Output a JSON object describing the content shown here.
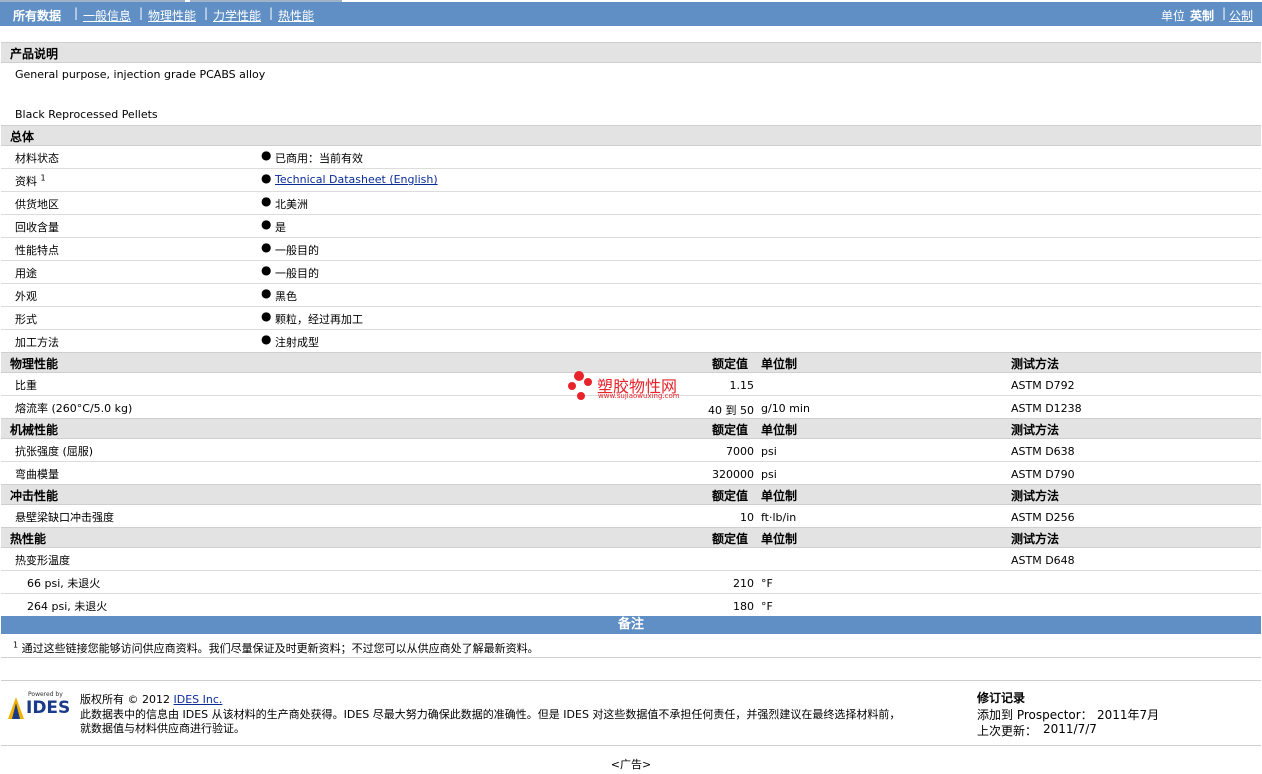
{
  "nav": {
    "items": [
      "所有数据",
      "一般信息",
      "物理性能",
      "力学性能",
      "热性能"
    ],
    "unit_label": "单位",
    "unit_english": "英制",
    "unit_metric": "公制"
  },
  "product": {
    "header": "产品说明",
    "line1": "General purpose, injection grade PCABS alloy",
    "line2": "Black Reprocessed Pellets"
  },
  "general": {
    "header": "总体",
    "rows": [
      {
        "label": "材料状态",
        "value": "已商用：当前有效"
      },
      {
        "label": "资料",
        "sup": "1",
        "value": "Technical Datasheet (English)"
      },
      {
        "label": "供货地区",
        "value": "北美洲"
      },
      {
        "label": "回收含量",
        "value": "是"
      },
      {
        "label": "性能特点",
        "value": "一般目的"
      },
      {
        "label": "用途",
        "value": "一般目的"
      },
      {
        "label": "外观",
        "value": "黑色"
      },
      {
        "label": "形式",
        "value": "颗粒，经过再加工"
      },
      {
        "label": "加工方法",
        "value": "注射成型"
      }
    ]
  },
  "columns": {
    "rated": "额定值",
    "unit": "单位制",
    "method": "测试方法"
  },
  "physical": {
    "header": "物理性能",
    "rows": [
      {
        "label": "比重",
        "value": "1.15",
        "unit": "",
        "method": "ASTM D792"
      },
      {
        "label": "熔流率 (260°C/5.0 kg)",
        "value": "40 到 50",
        "unit": "g/10 min",
        "method": "ASTM D1238"
      }
    ]
  },
  "mechanical": {
    "header": "机械性能",
    "rows": [
      {
        "label": "抗张强度 (屈服)",
        "value": "7000",
        "unit": "psi",
        "method": "ASTM D638"
      },
      {
        "label": "弯曲模量",
        "value": "320000",
        "unit": "psi",
        "method": "ASTM D790"
      }
    ]
  },
  "impact": {
    "header": "冲击性能",
    "rows": [
      {
        "label": "悬壁梁缺口冲击强度",
        "value": "10",
        "unit": "ft·lb/in",
        "method": "ASTM D256"
      }
    ]
  },
  "thermal": {
    "header": "热性能",
    "rows": [
      {
        "label": "热变形温度",
        "value": "",
        "unit": "",
        "method": "ASTM D648"
      },
      {
        "label": "66 psi, 未退火",
        "value": "210",
        "unit": "°F",
        "method": ""
      },
      {
        "label": "264 psi, 未退火",
        "value": "180",
        "unit": "°F",
        "method": ""
      }
    ]
  },
  "watermark": {
    "name": "塑胶物性网",
    "url": "www.sujiaowuxing.com"
  },
  "notes": {
    "header": "备注",
    "sup": "1",
    "text": "通过这些链接您能够访问供应商资料。我们尽量保证及时更新资料；不过您可以从供应商处了解最新资料。"
  },
  "footer": {
    "logo_top": "Powered by",
    "logo_brand": "IDES",
    "copyright_prefix": "版权所有 © 2012",
    "company_link": "IDES Inc.",
    "disclaimer1": "此数据表中的信息由 IDES 从该材料的生产商处获得。IDES 尽最大努力确保此数据的准确性。但是 IDES 对这些数据值不承担任何责任，并强烈建议在最终选择材料前，",
    "disclaimer2": "就数据值与材料供应商进行验证。",
    "revision_title": "修订记录",
    "added_label": "添加到 Prospector：",
    "added_value": "2011年7月",
    "updated_label": "上次更新：",
    "updated_value": "2011/7/7"
  },
  "ad": "<广告>"
}
